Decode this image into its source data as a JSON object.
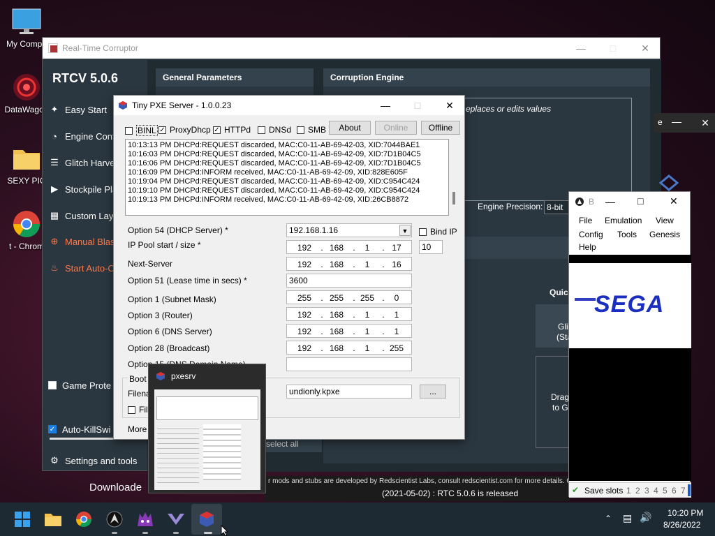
{
  "desktop": {
    "icons": [
      {
        "label": "My Compu",
        "name": "my-computer"
      },
      {
        "label": "DataWagon",
        "name": "datawagon"
      },
      {
        "label": "SEXY PIC",
        "name": "sexy-pic-folder"
      },
      {
        "label": "t - Chrom",
        "name": "chrome-shortcut"
      }
    ],
    "downloaded_text": "Downloade"
  },
  "rtcv": {
    "title": "Real-Time Corruptor",
    "brand": "RTCV 5.0.6",
    "nav": [
      {
        "label": "Easy Start",
        "icon": "wand-icon"
      },
      {
        "label": "Engine Confi",
        "icon": "gauge-icon"
      },
      {
        "label": "Glitch Harve",
        "icon": "layers-icon"
      },
      {
        "label": "Stockpile Pla",
        "icon": "play-icon"
      },
      {
        "label": "Custom Layo",
        "icon": "grid-icon"
      },
      {
        "label": "Manual Blas",
        "icon": "crosshair-icon"
      },
      {
        "label": "Start Auto-C",
        "icon": "flame-icon"
      }
    ],
    "game_protect": "Game Prote",
    "auto_killswitch": "Auto-KillSwi",
    "settings": "Settings and tools",
    "general_parameters": "General Parameters",
    "corruption_engine": "Corruption Engine",
    "engine_desc": "eplaces or edits values",
    "engine_precision_label": "Engine Precision:",
    "engine_precision_value": "8-bit",
    "quick": "Quic",
    "glitch_label_1": "Gli",
    "glitch_label_2": "(Sta",
    "drag_label_1": "Drag",
    "drag_label_2": "to G",
    "select_all": "select all",
    "footer_text": "r mods and stubs are developed by Redscientist Labs, consult redscientist.com for more details. Clic",
    "release_text": "(2021-05-02) : RTC 5.0.6 is released",
    "dark_win_letter": "e"
  },
  "pxe": {
    "title": "Tiny PXE Server - 1.0.0.23",
    "checkboxes": [
      {
        "label": "BINL",
        "checked": false
      },
      {
        "label": "ProxyDhcp",
        "checked": true
      },
      {
        "label": "HTTPd",
        "checked": true
      },
      {
        "label": "DNSd",
        "checked": false
      },
      {
        "label": "SMB",
        "checked": false
      }
    ],
    "about": "About",
    "online": "Online",
    "offline": "Offline",
    "log": [
      "10:13:13 PM DHCPd:REQUEST discarded, MAC:C0-11-AB-69-42-03, XID:7044BAE1",
      "10:16:03 PM DHCPd:REQUEST discarded, MAC:C0-11-AB-69-42-09, XID:7D1B04C5",
      "10:16:06 PM DHCPd:REQUEST discarded, MAC:C0-11-AB-69-42-09, XID:7D1B04C5",
      "10:16:09 PM DHCPd:INFORM received, MAC:C0-11-AB-69-42-09, XID:828E605F",
      "10:19:04 PM DHCPd:REQUEST discarded, MAC:C0-11-AB-69-42-09, XID:C954C424",
      "10:19:10 PM DHCPd:REQUEST discarded, MAC:C0-11-AB-69-42-09, XID:C954C424",
      "10:19:13 PM DHCPd:INFORM received, MAC:C0-11-AB-69-42-09, XID:26CB8872"
    ],
    "opt54_label": "Option 54 (DHCP Server) *",
    "opt54_value": "192.168.1.16",
    "bind_ip": "Bind IP",
    "pool_label": "IP Pool start / size *",
    "pool": [
      "192",
      "168",
      "1",
      "17"
    ],
    "pool_size": "10",
    "next_label": "Next-Server",
    "next": [
      "192",
      "168",
      "1",
      "16"
    ],
    "opt51_label": "Option 51 (Lease time in secs) *",
    "opt51_value": "3600",
    "opt1_label": "Option 1  (Subnet Mask)",
    "opt1": [
      "255",
      "255",
      "255",
      "0"
    ],
    "opt3_label": "Option 3  (Router)",
    "opt3": [
      "192",
      "168",
      "1",
      "1"
    ],
    "opt6_label": "Option 6  (DNS Server)",
    "opt6": [
      "192",
      "168",
      "1",
      "1"
    ],
    "opt28_label": "Option 28 (Broadcast)",
    "opt28": [
      "192",
      "168",
      "1",
      "255"
    ],
    "opt15_label": "Option 15 (DNS Domain Name)",
    "boot_label": "Boot F",
    "filename_label": "Filenar",
    "filename_value": "undionly.kpxe",
    "browse": "...",
    "file_label": "File",
    "more": "More"
  },
  "thumbnail": {
    "title": "pxesrv"
  },
  "emulator": {
    "title_letter": "B",
    "menu": [
      "File",
      "Emulation",
      "View",
      "Config",
      "Tools",
      "Genesis",
      "Help"
    ],
    "logo": "SEGA",
    "save_slots_label": "Save slots",
    "slots": [
      "1",
      "2",
      "3",
      "4",
      "5",
      "6",
      "7"
    ]
  },
  "taskbar": {
    "time": "10:20 PM",
    "date": "8/26/2022"
  }
}
